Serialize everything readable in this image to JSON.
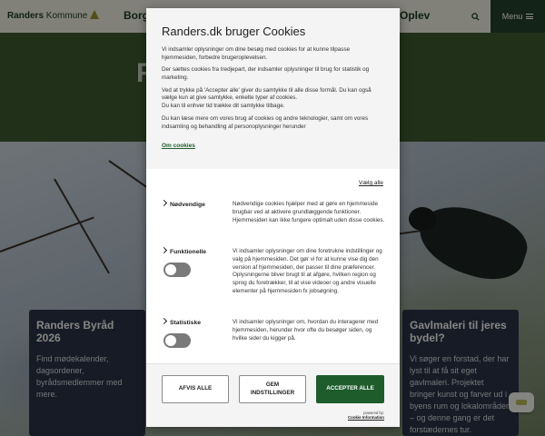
{
  "site": {
    "logo_text": "Randers",
    "logo_suffix": "Kommune",
    "nav_borger": "Borge",
    "nav_oplev": "Oplev",
    "menu_label": "Menu",
    "hero_title": "R",
    "card_left": {
      "title": "Randers Byråd 2026",
      "text": "Find mødekalender, dagsordener, byrådsmedlemmer med mere."
    },
    "card_right": {
      "title": "Gavlmaleri til jeres bydel?",
      "text": "Vi søger en forstad, der har lyst til at få sit eget gavlmaleri. Projektet bringer kunst og farver ud i byens rum og lokalområder – og denne gang er det forstædernes tur."
    }
  },
  "cookie_dialog": {
    "title": "Randers.dk bruger Cookies",
    "paragraphs": [
      "Vi indsamler oplysninger om dine besøg med cookies for at kunne tilpasse hjemmesiden, forbedre brugeroplevelsen.",
      "Der sættes cookies fra tredjepart, der indsamler oplysninger til brug for statistik og marketing.",
      "Ved at trykke på 'Accepter alle' giver du samtykke til alle disse formål. Du kan også vælge kun at give samtykke, enkelte typer af cookies.\nDu kan til enhver tid trække dit samtykke tilbage.",
      "Du kan læse mere om vores brug af cookies og andre teknologier, samt om vores indsamling og behandling af personoplysninger herunder"
    ],
    "about_link": "Om cookies",
    "select_all": "Vælg alle",
    "categories": [
      {
        "name": "Nødvendige",
        "description": "Nødvendige cookies hjælper med at gøre en hjemmeside brugbar ved at aktivere grundlæggende funktioner. Hjemmesiden kan ikke fungere optimalt uden disse cookies.",
        "has_toggle": false
      },
      {
        "name": "Funktionelle",
        "description": "Vi indsamler oplysninger om dine foretrukne indstillinger og valg på hjemmesiden. Det gør vi for at kunne vise dig den version af hjemmesiden, der passer til dine præferencer. Oplysningerne bliver brugt til at afgøre, hvilken region og sprog du foretrækker, til at vise videoer og andre visuelle elementer på hjemmesiden fx jobsøgning.",
        "has_toggle": true,
        "enabled": false
      },
      {
        "name": "Statistiske",
        "description": "Vi indsamler oplysninger om, hvordan du interagerer med hjemmesiden, herunder hvor ofte du besøger siden, og hvilke sider du kigger på.",
        "has_toggle": true,
        "enabled": false
      }
    ],
    "buttons": {
      "reject": "AFVIS ALLE",
      "settings_line1": "GEM",
      "settings_line2": "INDSTILLINGER",
      "accept": "ACCEPTER ALLE"
    },
    "powered_by": "powered by:",
    "powered_link": "Cookie Information",
    "colors": {
      "accent": "#1f5c2c",
      "toggle_off": "#7a7a7a",
      "header_bg": "#f4f4f4"
    }
  }
}
